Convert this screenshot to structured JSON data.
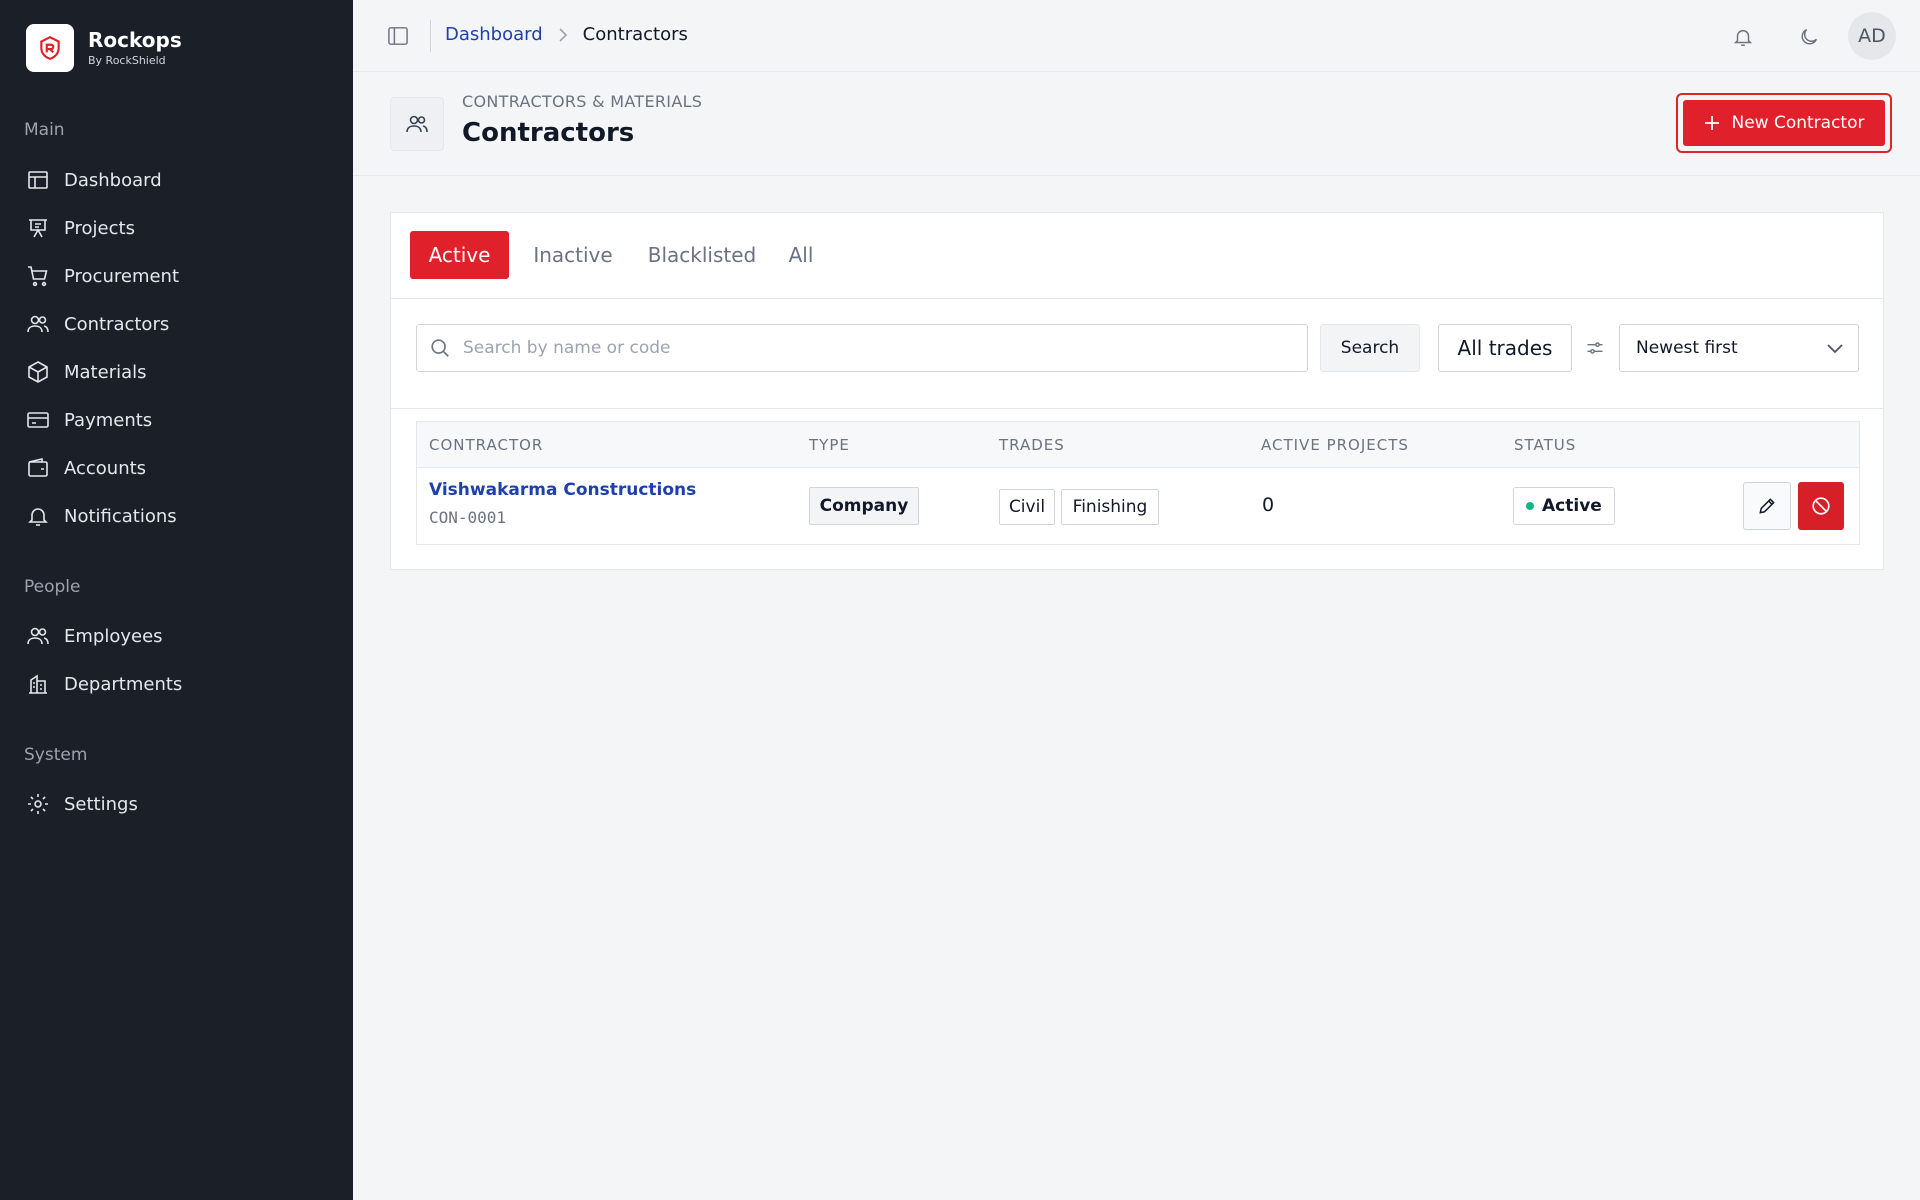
{
  "brand": {
    "name": "Rockops",
    "subtitle": "By RockShield",
    "accent": "#e0202a"
  },
  "sidebar": {
    "sections": [
      {
        "label": "Main",
        "items": [
          {
            "label": "Dashboard",
            "icon": "dashboard-icon"
          },
          {
            "label": "Projects",
            "icon": "projects-icon"
          },
          {
            "label": "Procurement",
            "icon": "cart-icon"
          },
          {
            "label": "Contractors",
            "icon": "users-icon"
          },
          {
            "label": "Materials",
            "icon": "box-icon"
          },
          {
            "label": "Payments",
            "icon": "card-icon"
          },
          {
            "label": "Accounts",
            "icon": "wallet-icon"
          },
          {
            "label": "Notifications",
            "icon": "bell-icon"
          }
        ]
      },
      {
        "label": "People",
        "items": [
          {
            "label": "Employees",
            "icon": "users-icon"
          },
          {
            "label": "Departments",
            "icon": "building-icon"
          }
        ]
      },
      {
        "label": "System",
        "items": [
          {
            "label": "Settings",
            "icon": "gear-icon"
          }
        ]
      }
    ]
  },
  "topbar": {
    "breadcrumb": {
      "parent": "Dashboard",
      "current": "Contractors"
    },
    "avatar_initials": "AD"
  },
  "header": {
    "eyebrow": "CONTRACTORS & MATERIALS",
    "title": "Contractors",
    "new_button": "New Contractor"
  },
  "tabs": [
    "Active",
    "Inactive",
    "Blacklisted",
    "All"
  ],
  "active_tab": "Active",
  "filters": {
    "search_placeholder": "Search by name or code",
    "search_button": "Search",
    "trades": "All trades",
    "sort": "Newest first"
  },
  "table": {
    "columns": [
      "CONTRACTOR",
      "TYPE",
      "TRADES",
      "ACTIVE PROJECTS",
      "STATUS"
    ],
    "rows": [
      {
        "name": "Vishwakarma Constructions",
        "code": "CON-0001",
        "type": "Company",
        "trades": [
          "Civil",
          "Finishing"
        ],
        "active_projects": "0",
        "status": "Active"
      }
    ]
  }
}
